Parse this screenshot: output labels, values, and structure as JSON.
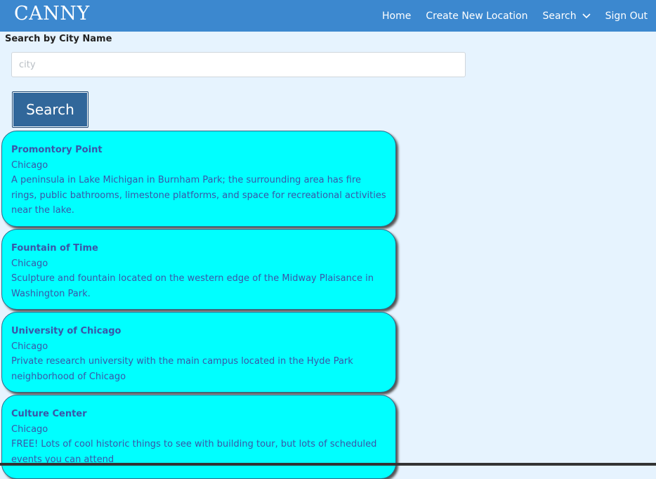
{
  "navbar": {
    "brand": "CANNY",
    "links": [
      {
        "label": "Home"
      },
      {
        "label": "Create New Location"
      },
      {
        "label": "Search"
      },
      {
        "label": "Sign Out"
      }
    ]
  },
  "search": {
    "label": "Search by City Name",
    "placeholder": "city",
    "button_label": "Search"
  },
  "locations": [
    {
      "name": "Promontory Point",
      "city": "Chicago",
      "description": "A peninsula in Lake Michigan in Burnham Park; the surrounding area has fire rings, public bathrooms, limestone platforms, and space for recreational activities near the lake."
    },
    {
      "name": "Fountain of Time",
      "city": "Chicago",
      "description": "Sculpture and fountain located on the western edge of the Midway Plaisance in Washington Park."
    },
    {
      "name": "University of Chicago",
      "city": "Chicago",
      "description": "Private research university with the main campus located in the Hyde Park neighborhood of Chicago"
    },
    {
      "name": "Culture Center",
      "city": "Chicago",
      "description": "FREE! Lots of cool historic things to see with building tour, but lots of scheduled events you can attend"
    }
  ],
  "colors": {
    "navbar": "#3c88cf",
    "page_background": "#e6f3fe",
    "card_background": "#00ffff",
    "card_text": "#3a56a8",
    "button": "#31679a"
  }
}
